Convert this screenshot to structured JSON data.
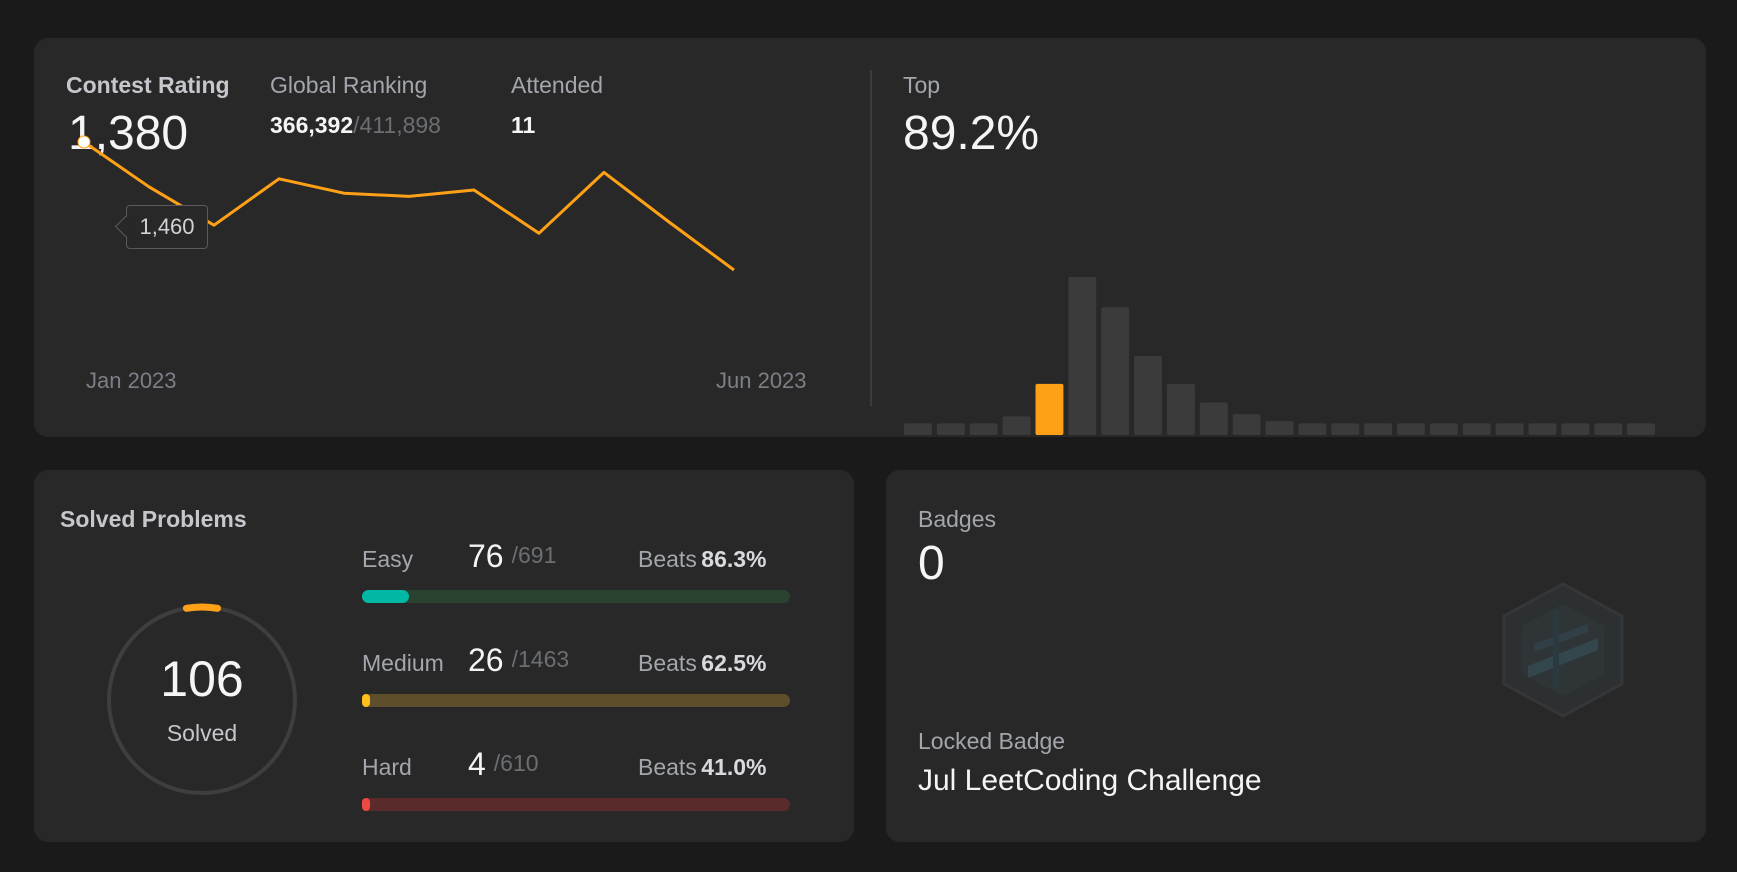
{
  "contest": {
    "rating_label": "Contest Rating",
    "rating_value": "1,380",
    "ranking_label": "Global Ranking",
    "ranking_value": "366,392",
    "ranking_total": "/411,898",
    "attended_label": "Attended",
    "attended_value": "11",
    "tooltip_value": "1,460",
    "top_label": "Top",
    "top_value": "89.2%"
  },
  "chart_data": [
    {
      "type": "line",
      "x": [
        "Jan 2023",
        "",
        "",
        "",
        "",
        "",
        "",
        "",
        "",
        "",
        "Jun 2023"
      ],
      "tick_labels": [
        "Jan 2023",
        "Jun 2023"
      ],
      "series": [
        {
          "values": [
            1460,
            1432,
            1408,
            1437,
            1428,
            1426,
            1430,
            1403,
            1441,
            1410,
            1380
          ],
          "color": "#ffa116"
        }
      ],
      "highlighted_point": 1460,
      "ylim": [
        1300,
        1500
      ],
      "grid": false
    },
    {
      "type": "bar",
      "values": [
        5,
        5,
        5,
        8,
        22,
        68,
        55,
        34,
        22,
        14,
        9,
        6,
        5,
        5,
        5,
        5,
        5,
        5,
        5,
        5,
        5,
        5,
        5
      ],
      "highlight_index": 4,
      "bar_color": "#3b3b3b",
      "highlight_color": "#ffa116",
      "grid": false
    }
  ],
  "solved": {
    "title": "Solved Problems",
    "total": "106",
    "total_label": "Solved",
    "ring_fraction": 0.0536,
    "rows": [
      {
        "name": "Easy",
        "count": "76",
        "total": "/691",
        "beats_label": "Beats",
        "beats_value": "86.3%",
        "fraction": 0.11,
        "fill_color": "#00b8a3",
        "track_color": "#2a4330"
      },
      {
        "name": "Medium",
        "count": "26",
        "total": "/1463",
        "beats_label": "Beats",
        "beats_value": "62.5%",
        "fraction": 0.018,
        "fill_color": "#ffc01e",
        "track_color": "#5e4e2b"
      },
      {
        "name": "Hard",
        "count": "4",
        "total": "/610",
        "beats_label": "Beats",
        "beats_value": "41.0%",
        "fraction": 0.007,
        "fill_color": "#ef4743",
        "track_color": "#5b2a2a"
      }
    ]
  },
  "badges": {
    "label": "Badges",
    "count": "0",
    "locked_label": "Locked Badge",
    "locked_name": "Jul LeetCoding Challenge",
    "badge_icon": "locked-hexagon-badge-icon"
  }
}
